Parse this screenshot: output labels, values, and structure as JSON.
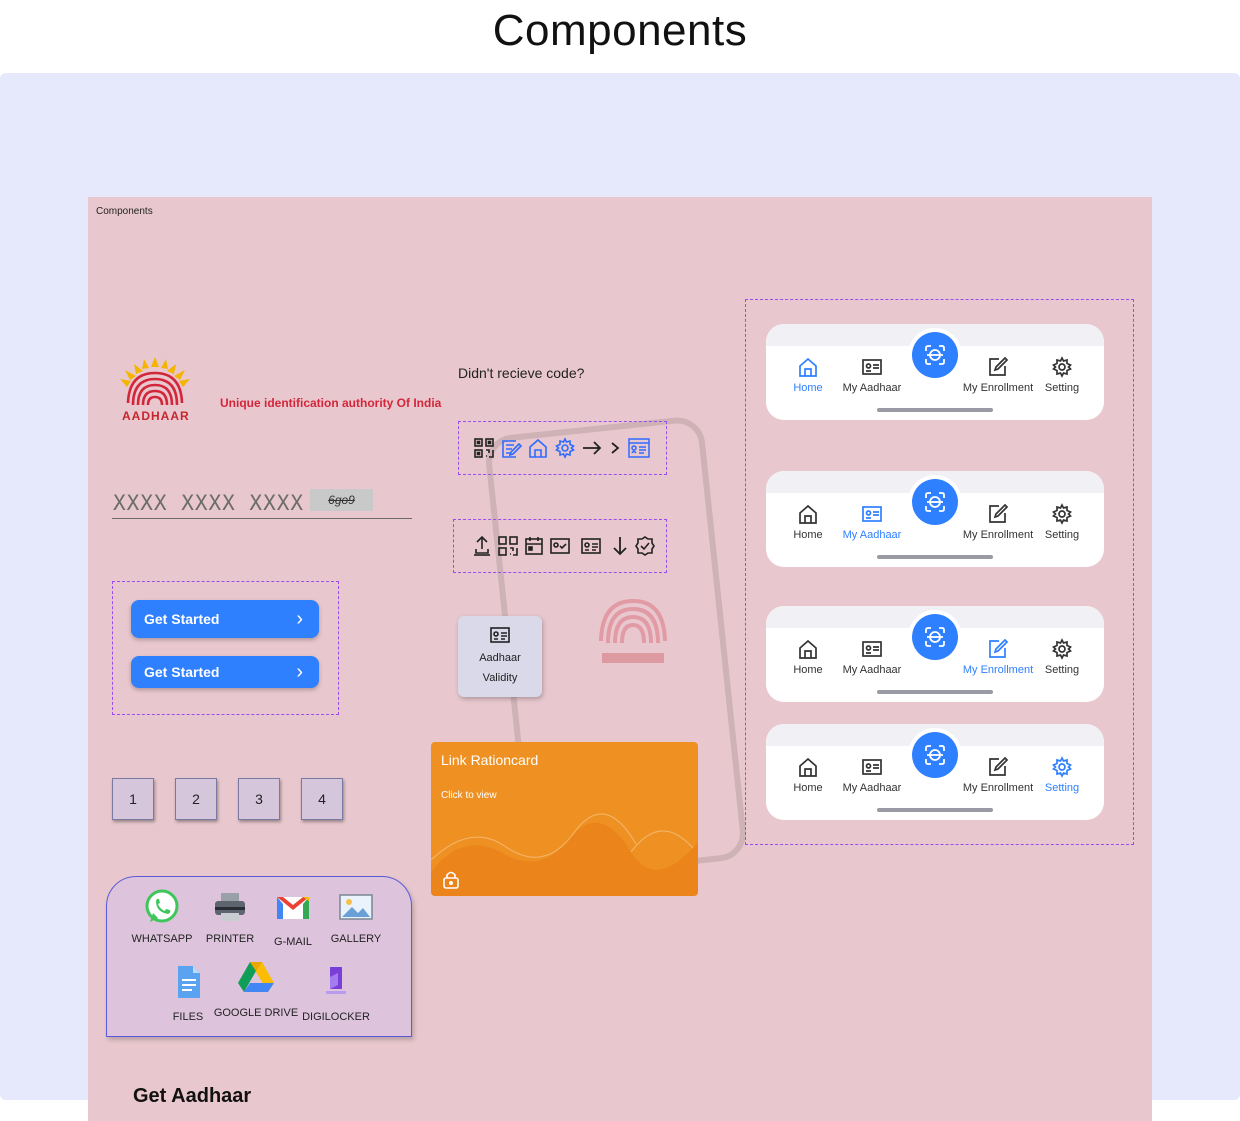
{
  "page_title": "Components",
  "frame_label": "Components",
  "logo": {
    "subtitle": "Unique identification authority Of India",
    "wordmark": "AADHAAR"
  },
  "aadhaar_input": {
    "mask": "XXXX XXXX XXXX",
    "captcha": "6go9"
  },
  "buttons": {
    "get_started_1": "Get Started",
    "get_started_2": "Get Started"
  },
  "pagination": [
    "1",
    "2",
    "3",
    "4"
  ],
  "share_sheet": {
    "apps": [
      {
        "label": "WHATSAPP",
        "icon": "whatsapp-icon"
      },
      {
        "label": "PRINTER",
        "icon": "printer-icon"
      },
      {
        "label": "G-MAIL",
        "icon": "gmail-icon"
      },
      {
        "label": "GALLERY",
        "icon": "gallery-icon"
      },
      {
        "label": "FILES",
        "icon": "files-icon"
      },
      {
        "label": "GOOGLE DRIVE",
        "icon": "google-drive-icon"
      },
      {
        "label": "DIGILOCKER",
        "icon": "digilocker-icon"
      }
    ]
  },
  "get_aadhaar": "Get Aadhaar",
  "resend_text": "Didn't recieve code?",
  "icon_set_1": [
    "qr-code-icon",
    "edit-document-icon",
    "home-icon",
    "gear-icon",
    "arrow-right-icon",
    "chevron-right-icon",
    "id-card-icon"
  ],
  "icon_set_2": [
    "upload-icon",
    "qr-code-icon",
    "calendar-icon",
    "id-check-icon",
    "id-card-icon",
    "arrow-down-icon",
    "verified-icon"
  ],
  "validity_card": {
    "line1": "Aadhaar",
    "line2": "Validity"
  },
  "ration_card": {
    "title": "Link Rationcard",
    "subtitle": "Click to view"
  },
  "nav": {
    "labels": [
      "Home",
      "My Aadhaar",
      "My Enrollment",
      "Setting"
    ],
    "active_index_per_bar": [
      0,
      1,
      2,
      3
    ]
  },
  "colors": {
    "accent": "#2f80ff",
    "frame_bg": "#e8c8ce",
    "stage_bg": "#e6e8fc",
    "ration_orange": "#ee9122",
    "dash_purple": "#9a4cf0",
    "aadhaar_red": "#d3263a"
  }
}
